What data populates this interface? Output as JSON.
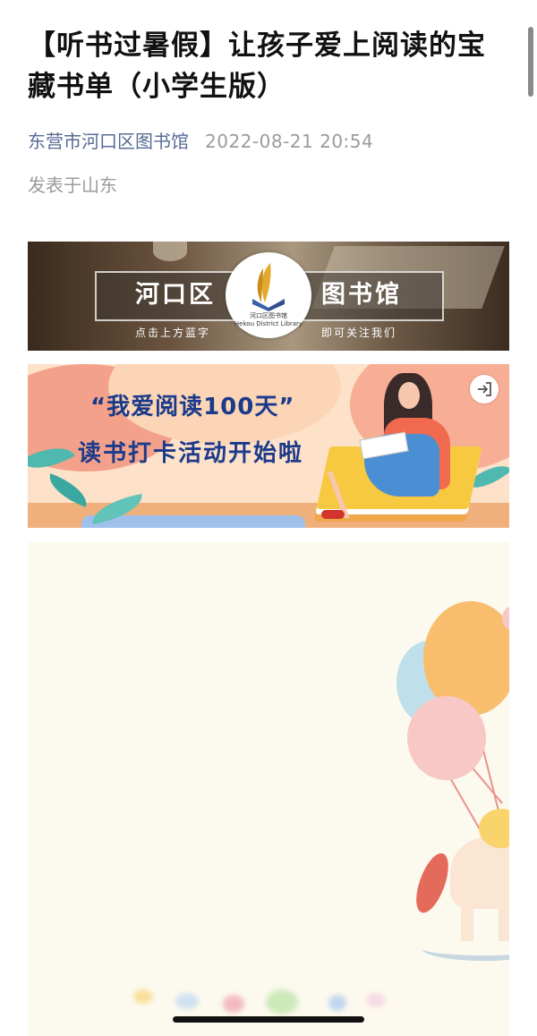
{
  "article": {
    "title": "【听书过暑假】让孩子爱上阅读的宝藏书单（小学生版）",
    "author": "东营市河口区图书馆",
    "publish_time": "2022-08-21 20:54",
    "location": "发表于山东"
  },
  "banner_library": {
    "name_left": "河口区",
    "name_right": "图书馆",
    "logo_text": "河口区图书馆",
    "logo_en": "Hekou District Library",
    "hint_left": "点击上方蓝字",
    "hint_right": "即可关注我们"
  },
  "banner_reading": {
    "headline": "“我爱阅读100天”",
    "subline": "读书打卡活动开始啦",
    "icon": "exit-icon"
  },
  "colors": {
    "author_link": "#576b95",
    "meta_gray": "#9b9b9b",
    "headline_blue": "#1c3a8a"
  }
}
